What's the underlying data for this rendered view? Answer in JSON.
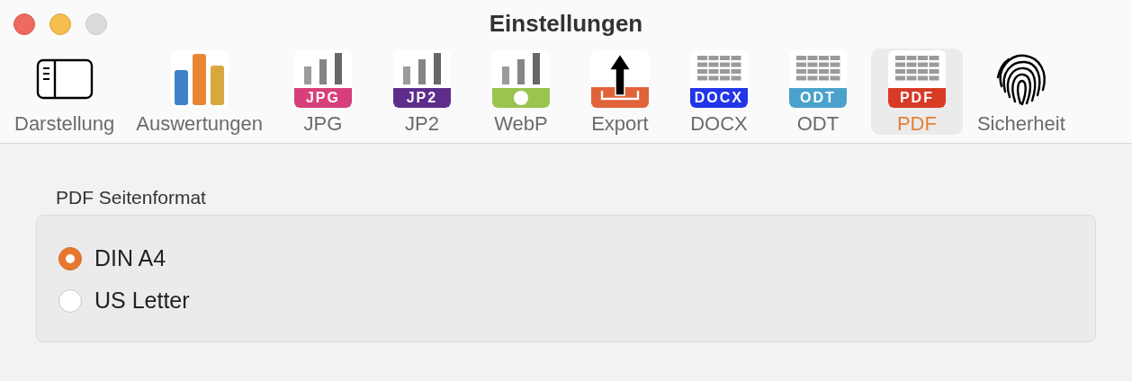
{
  "window": {
    "title": "Einstellungen"
  },
  "tabs": [
    {
      "label": "Darstellung",
      "selected": false,
      "kind": "layout"
    },
    {
      "label": "Auswertungen",
      "selected": false,
      "kind": "chart"
    },
    {
      "label": "JPG",
      "selected": false,
      "kind": "bars",
      "badge": "JPG",
      "color": "#d63f7a"
    },
    {
      "label": "JP2",
      "selected": false,
      "kind": "bars",
      "badge": "JP2",
      "color": "#5e2d8c"
    },
    {
      "label": "WebP",
      "selected": false,
      "kind": "dot",
      "color": "#98c44f"
    },
    {
      "label": "Export",
      "selected": false,
      "kind": "export",
      "color": "#e0633a"
    },
    {
      "label": "DOCX",
      "selected": false,
      "kind": "grid",
      "badge": "DOCX",
      "color": "#2235e8"
    },
    {
      "label": "ODT",
      "selected": false,
      "kind": "grid",
      "badge": "ODT",
      "color": "#4aa2cc"
    },
    {
      "label": "PDF",
      "selected": true,
      "kind": "grid",
      "badge": "PDF",
      "color": "#d93a26"
    },
    {
      "label": "Sicherheit",
      "selected": false,
      "kind": "fingerprint"
    }
  ],
  "section": {
    "title": "PDF Seitenformat",
    "options": [
      {
        "label": "DIN A4",
        "selected": true
      },
      {
        "label": "US Letter",
        "selected": false
      }
    ]
  }
}
